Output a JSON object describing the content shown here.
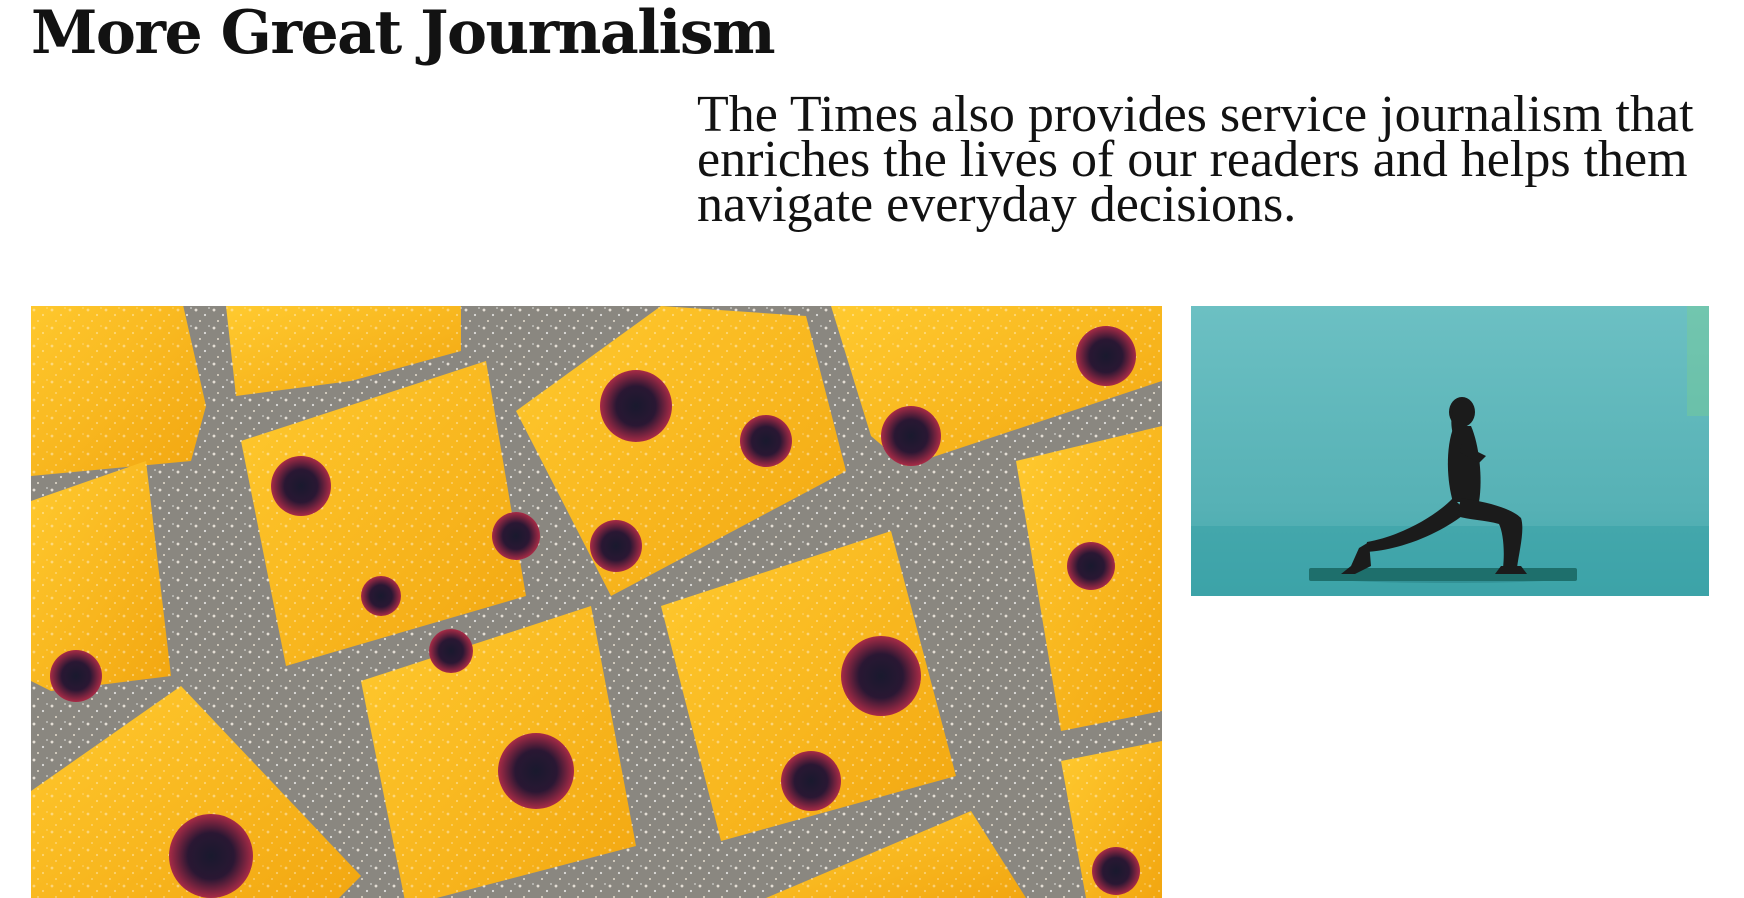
{
  "section": {
    "title": "More Great Journalism",
    "description": "The Times also provides service journalism that enriches the lives of our readers and helps them navigate everyday decisions."
  },
  "images": [
    {
      "subject": "lemon-blueberry-bars",
      "accent": "#f2b51d"
    },
    {
      "subject": "yoga-lunge-pose",
      "accent": "#5fb6b9"
    }
  ],
  "colors": {
    "text": "#121212",
    "background": "#ffffff"
  }
}
